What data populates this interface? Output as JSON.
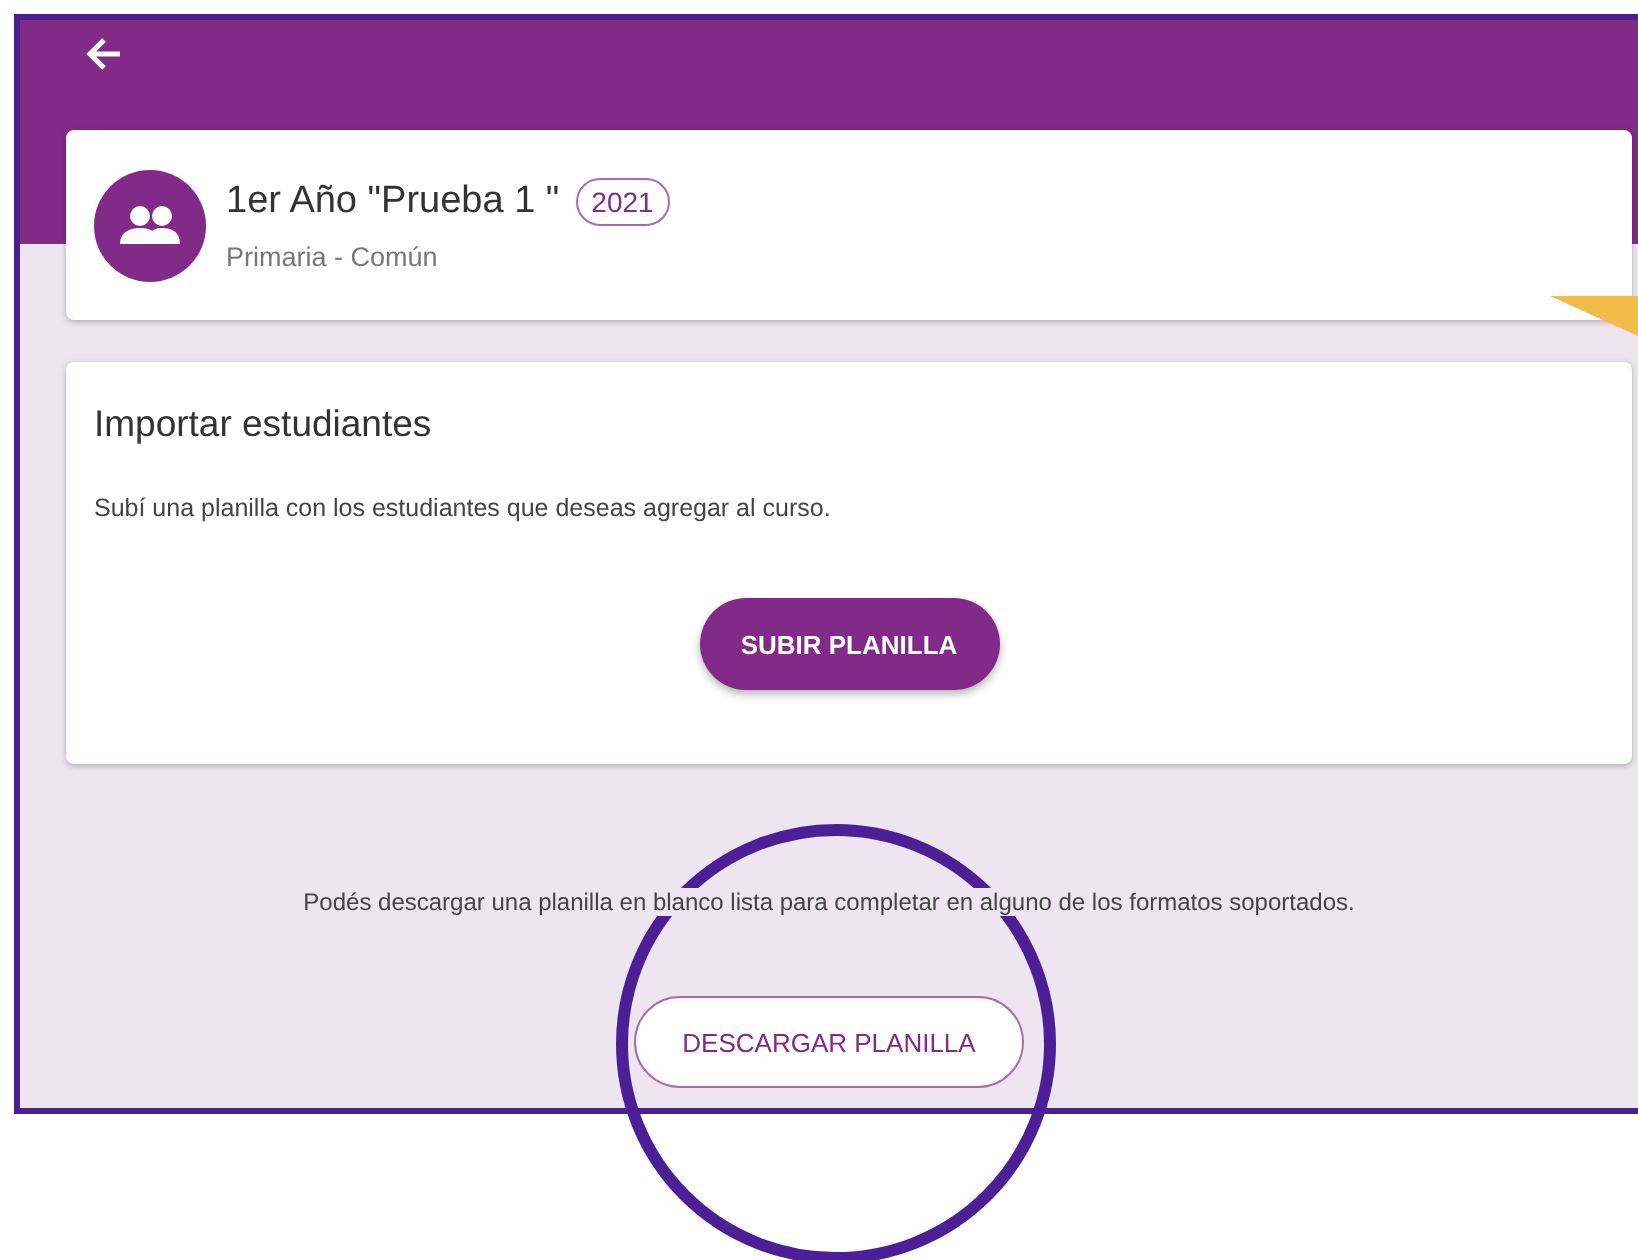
{
  "course": {
    "title": "1er Año \"Prueba 1 \"",
    "year": "2021",
    "subtitle": "Primaria - Común"
  },
  "import_card": {
    "title": "Importar estudiantes",
    "description": "Subí una planilla con los estudiantes que deseas agregar al curso.",
    "button": "SUBIR PLANILLA"
  },
  "download": {
    "text": "Podés descargar una planilla en blanco lista para completar en alguno de los formatos soportados.",
    "button": "DESCARGAR PLANILLA"
  },
  "annotation": {
    "kind": "circle"
  }
}
